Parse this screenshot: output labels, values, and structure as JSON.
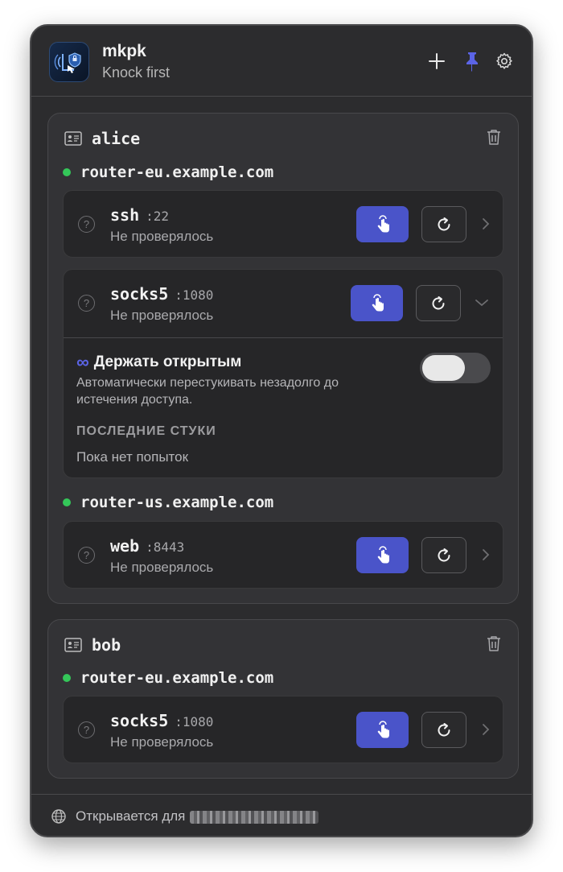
{
  "app": {
    "title": "mkpk",
    "subtitle": "Knock first"
  },
  "header_actions": {
    "add_icon": "plus-icon",
    "pin_icon": "pin-icon",
    "settings_icon": "gear-icon",
    "pin_color": "#5b64e6"
  },
  "users": [
    {
      "name": "alice",
      "hosts": [
        {
          "name": "router-eu.example.com",
          "ports": [
            {
              "name": "ssh",
              "port": ":22",
              "status": "Не проверялось"
            },
            {
              "name": "socks5",
              "port": ":1080",
              "status": "Не проверялось",
              "keep_open": {
                "icon": "∞",
                "title": "Держать открытым",
                "description": "Автоматически перестукивать незадолго до истечения доступа.",
                "enabled": false
              },
              "recent": {
                "title": "ПОСЛЕДНИЕ СТУКИ",
                "empty": "Пока нет попыток"
              }
            }
          ]
        },
        {
          "name": "router-us.example.com",
          "ports": [
            {
              "name": "web",
              "port": ":8443",
              "status": "Не проверялось"
            }
          ]
        }
      ]
    },
    {
      "name": "bob",
      "hosts": [
        {
          "name": "router-eu.example.com",
          "ports": [
            {
              "name": "socks5",
              "port": ":1080",
              "status": "Не проверялось"
            }
          ]
        }
      ]
    }
  ],
  "footer": {
    "text": "Открывается для"
  },
  "colors": {
    "accent": "#4a54c9",
    "online": "#34c759"
  }
}
